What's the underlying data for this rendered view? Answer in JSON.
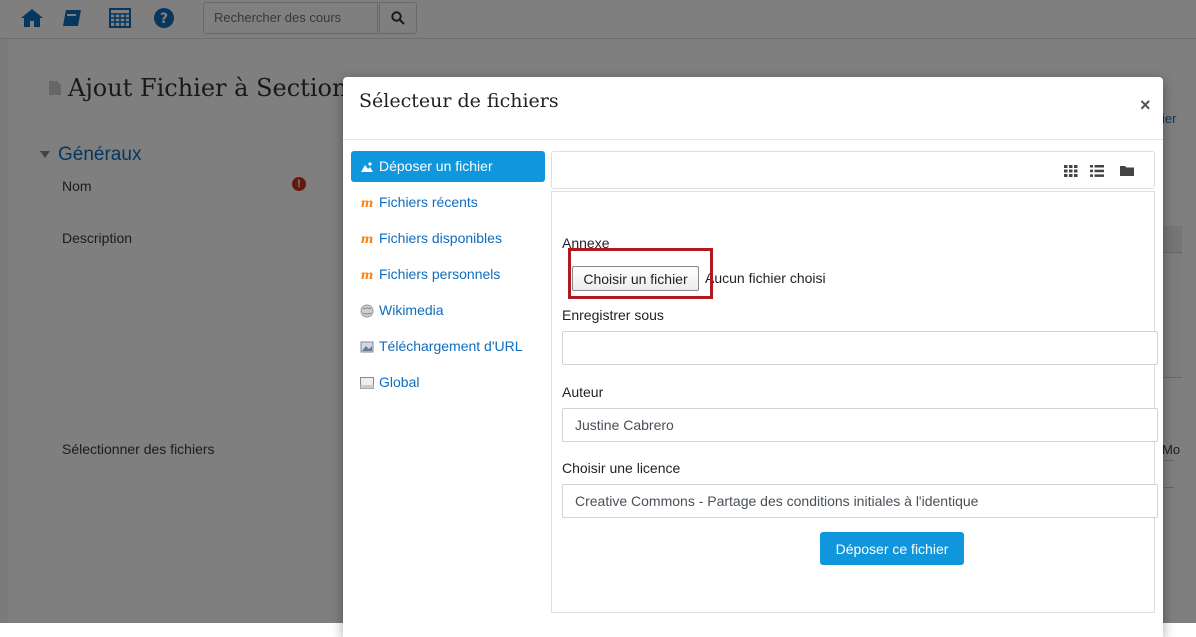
{
  "topbar": {
    "icons": [
      "home-icon",
      "book-icon",
      "calendar-icon",
      "help-icon"
    ],
    "search_placeholder": "Rechercher des cours",
    "search_button_icon": "search-icon"
  },
  "page": {
    "title": "Ajout Fichier à Section",
    "section": "Généraux",
    "labels": {
      "name": "Nom",
      "description": "Description",
      "select_files": "Sélectionner des fichiers"
    },
    "required_icon": "exclamation-circle-icon",
    "right_fragment_top": "ier",
    "right_fragment_mid": "Mo"
  },
  "modal": {
    "title": "Sélecteur de fichiers",
    "close_icon": "close-icon",
    "repositories": [
      {
        "label": "Déposer un fichier",
        "icon": "upload-icon",
        "active": true
      },
      {
        "label": "Fichiers récents",
        "icon": "moodle-icon",
        "active": false
      },
      {
        "label": "Fichiers disponibles",
        "icon": "moodle-icon",
        "active": false
      },
      {
        "label": "Fichiers personnels",
        "icon": "moodle-icon",
        "active": false
      },
      {
        "label": "Wikimedia",
        "icon": "wikimedia-icon",
        "active": false
      },
      {
        "label": "Téléchargement d'URL",
        "icon": "url-download-icon",
        "active": false
      },
      {
        "label": "Global",
        "icon": "global-icon",
        "active": false
      }
    ],
    "view_icons": [
      "grid-view-icon",
      "list-view-icon",
      "folder-view-icon"
    ],
    "form": {
      "attachment_label": "Annexe",
      "choose_file_button": "Choisir un fichier",
      "no_file_text": "Aucun fichier choisi",
      "save_as_label": "Enregistrer sous",
      "save_as_value": "",
      "author_label": "Auteur",
      "author_value": "Justine Cabrero",
      "license_label": "Choisir une licence",
      "license_value": "Creative Commons - Partage des conditions initiales à l'identique",
      "upload_button": "Déposer ce fichier"
    }
  },
  "colors": {
    "accent": "#0f96dc",
    "link": "#0f6cbf",
    "highlight": "#b0191d",
    "required": "#ca3120"
  }
}
